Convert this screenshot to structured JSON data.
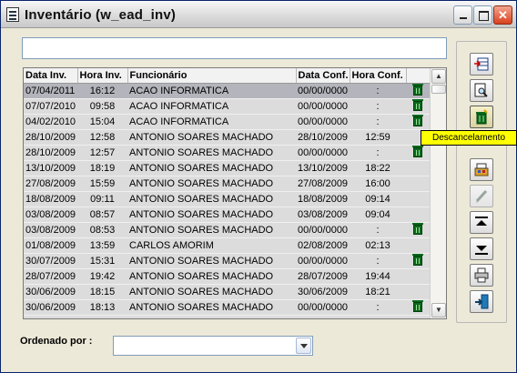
{
  "window": {
    "title": "Inventário (w_ead_inv)"
  },
  "titlebar_buttons": {
    "minimize": "",
    "maximize": "",
    "close": "✕"
  },
  "search": {
    "value": ""
  },
  "grid": {
    "columns": [
      "Data Inv.",
      "Hora Inv.",
      "Funcionário",
      "Data Conf.",
      "Hora Conf.",
      ""
    ],
    "rows": [
      [
        "07/04/2011",
        "16:12",
        "ACAO INFORMATICA",
        "00/00/0000",
        ":",
        "trash"
      ],
      [
        "07/07/2010",
        "09:58",
        "ACAO INFORMATICA",
        "00/00/0000",
        ":",
        "trash"
      ],
      [
        "04/02/2010",
        "15:04",
        "ACAO INFORMATICA",
        "00/00/0000",
        ":",
        "trash"
      ],
      [
        "28/10/2009",
        "12:58",
        "ANTONIO SOARES MACHADO",
        "28/10/2009",
        "12:59",
        ""
      ],
      [
        "28/10/2009",
        "12:57",
        "ANTONIO SOARES MACHADO",
        "00/00/0000",
        ":",
        "trash"
      ],
      [
        "13/10/2009",
        "18:19",
        "ANTONIO SOARES MACHADO",
        "13/10/2009",
        "18:22",
        ""
      ],
      [
        "27/08/2009",
        "15:59",
        "ANTONIO SOARES MACHADO",
        "27/08/2009",
        "16:00",
        ""
      ],
      [
        "18/08/2009",
        "09:11",
        "ANTONIO SOARES MACHADO",
        "18/08/2009",
        "09:14",
        ""
      ],
      [
        "03/08/2009",
        "08:57",
        "ANTONIO SOARES MACHADO",
        "03/08/2009",
        "09:04",
        ""
      ],
      [
        "03/08/2009",
        "08:53",
        "ANTONIO SOARES MACHADO",
        "00/00/0000",
        ":",
        "trash"
      ],
      [
        "01/08/2009",
        "13:59",
        "CARLOS AMORIM",
        "02/08/2009",
        "02:13",
        ""
      ],
      [
        "30/07/2009",
        "15:31",
        "ANTONIO SOARES MACHADO",
        "00/00/0000",
        ":",
        "trash"
      ],
      [
        "28/07/2009",
        "19:42",
        "ANTONIO SOARES MACHADO",
        "28/07/2009",
        "19:44",
        ""
      ],
      [
        "30/06/2009",
        "18:15",
        "ANTONIO SOARES MACHADO",
        "30/06/2009",
        "18:21",
        ""
      ],
      [
        "30/06/2009",
        "18:13",
        "ANTONIO SOARES MACHADO",
        "00/00/0000",
        ":",
        "trash"
      ]
    ],
    "selected_row": 0
  },
  "scrollbar": {
    "up": "▲",
    "down": "▼"
  },
  "toolbar": {
    "buttons": [
      {
        "name": "insert-row-button",
        "icon": "insert-row-icon",
        "state": "normal"
      },
      {
        "name": "preview-button",
        "icon": "magnify-page-icon",
        "state": "normal"
      },
      {
        "name": "descancelamento-button",
        "icon": "trash-bin-icon",
        "state": "active"
      },
      {
        "name": "print-preview-button",
        "icon": "box-print-icon",
        "state": "normal"
      },
      {
        "name": "edit-button",
        "icon": "pencil-icon",
        "state": "disabled"
      },
      {
        "name": "move-top-button",
        "icon": "arrow-up-bar-icon",
        "state": "normal"
      },
      {
        "name": "move-bottom-button",
        "icon": "arrow-down-bar-icon",
        "state": "normal"
      },
      {
        "name": "print-button",
        "icon": "printer-icon",
        "state": "normal"
      },
      {
        "name": "exit-button",
        "icon": "exit-door-icon",
        "state": "normal"
      }
    ]
  },
  "tooltip": {
    "text": "Descancelamento"
  },
  "order": {
    "label": "Ordenado por :",
    "value": ""
  },
  "colors": {
    "window_bg": "#ece9d8",
    "grid_bg": "#dcdcdc",
    "selected_row": "#b4b4bc",
    "tooltip_bg": "#ffff00",
    "trash_green": "#0b6a1d"
  }
}
